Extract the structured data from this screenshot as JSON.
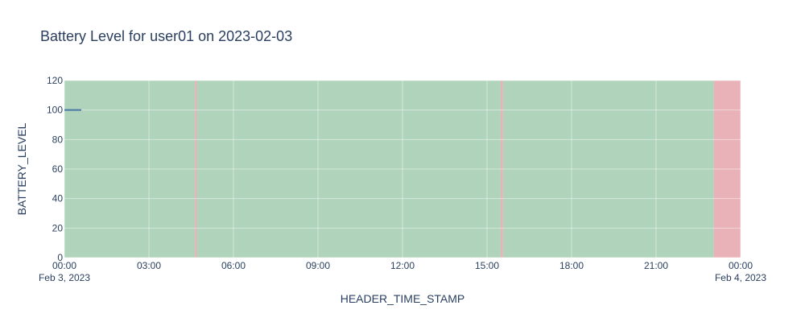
{
  "chart_data": {
    "type": "line",
    "title": "Battery Level for user01 on 2023-02-03",
    "xlabel": "HEADER_TIME_STAMP",
    "ylabel": "BATTERY_LEVEL",
    "xlim": [
      "2023-02-03 00:00",
      "2023-02-04 00:00"
    ],
    "ylim": [
      0,
      120
    ],
    "x_tick_labels": [
      "00:00",
      "03:00",
      "06:00",
      "09:00",
      "12:00",
      "15:00",
      "18:00",
      "21:00",
      "00:00"
    ],
    "x_tick_date_labels": [
      "Feb 3, 2023",
      "",
      "",
      "",
      "",
      "",
      "",
      "",
      "Feb 4, 2023"
    ],
    "y_tick_labels": [
      "0",
      "20",
      "40",
      "60",
      "80",
      "100",
      "120"
    ],
    "grid": true,
    "series": [
      {
        "x": [
          "2023-02-03 00:00",
          "2023-02-03 00:36"
        ],
        "y": [
          100,
          100
        ],
        "color": "#4c78a8"
      }
    ],
    "shaded_regions": [
      {
        "start": "2023-02-03 00:00",
        "end": "2023-02-03 04:38",
        "color": "#b0d3bb"
      },
      {
        "start": "2023-02-03 04:38",
        "end": "2023-02-03 04:42",
        "color": "#e9b2b8"
      },
      {
        "start": "2023-02-03 04:42",
        "end": "2023-02-03 15:29",
        "color": "#b0d3bb"
      },
      {
        "start": "2023-02-03 15:29",
        "end": "2023-02-03 15:34",
        "color": "#e9b2b8"
      },
      {
        "start": "2023-02-03 15:34",
        "end": "2023-02-03 23:03",
        "color": "#b0d3bb"
      },
      {
        "start": "2023-02-03 23:03",
        "end": "2023-02-04 00:00",
        "color": "#e9b2b8"
      }
    ]
  }
}
